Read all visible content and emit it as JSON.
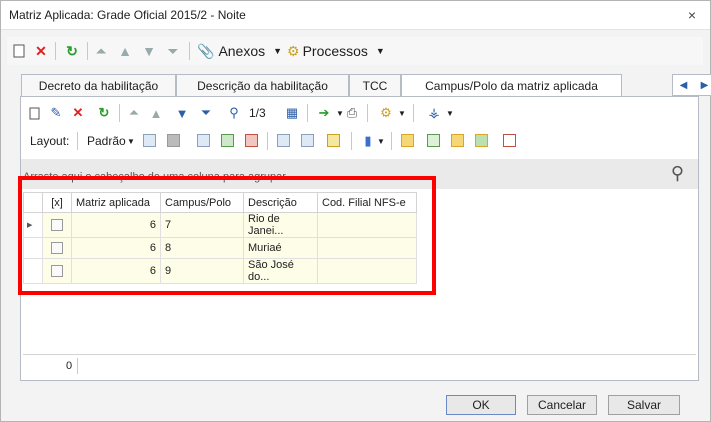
{
  "window": {
    "title": "Matriz Aplicada: Grade Oficial 2015/2 - Noite",
    "close_icon": "×"
  },
  "main_toolbar": {
    "anexos_label": "Anexos",
    "processos_label": "Processos"
  },
  "tabs": [
    {
      "label": "Decreto da habilitação",
      "active": false
    },
    {
      "label": "Descrição da habilitação",
      "active": false
    },
    {
      "label": "TCC",
      "active": false
    },
    {
      "label": "Campus/Polo da matriz aplicada",
      "active": true
    }
  ],
  "grid_toolbar": {
    "record_counter": "1/3"
  },
  "layout_bar": {
    "layout_label": "Layout:",
    "layout_value": "Padrão"
  },
  "group_hint": "Arraste aqui o cabeçalho de uma coluna para agrupar",
  "columns": [
    "[x]",
    "Matriz aplicada",
    "Campus/Polo",
    "Descrição",
    "Cod. Filial NFS-e"
  ],
  "rows": [
    {
      "matriz": "6",
      "campus": "7",
      "descricao": "Rio de Janei...",
      "cod": ""
    },
    {
      "matriz": "6",
      "campus": "8",
      "descricao": "Muriaé",
      "cod": ""
    },
    {
      "matriz": "6",
      "campus": "9",
      "descricao": "São José do...",
      "cod": ""
    }
  ],
  "footer": {
    "count": "0"
  },
  "buttons": {
    "ok": "OK",
    "cancel": "Cancelar",
    "save": "Salvar"
  },
  "colors": {
    "highlight": "#ff0000",
    "row_bg": "#fdfde8"
  }
}
